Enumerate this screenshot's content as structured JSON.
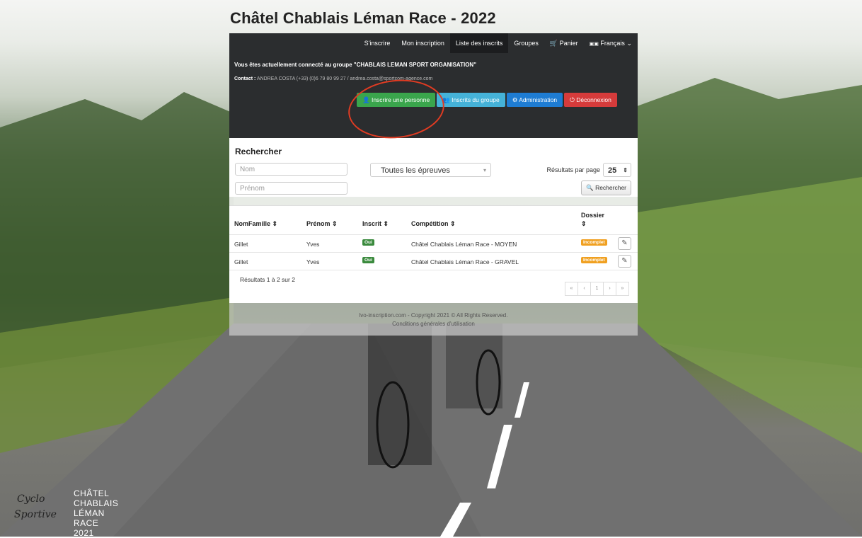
{
  "page_title": "Châtel Chablais Léman Race - 2022",
  "nav": {
    "items": [
      "S'inscrire",
      "Mon inscription",
      "Liste des inscrits",
      "Groupes",
      "Panier",
      "Français"
    ],
    "cart_icon": "cart-icon",
    "flag_icon": "flag-icon"
  },
  "info": {
    "connected": "Vous êtes actuellement connecté au groupe \"CHABLAIS LEMAN SPORT ORGANISATION\"",
    "contact_label": "Contact :",
    "contact_value": "ANDREA COSTA (+33) (0)6 79 80 99 27 / andrea.costa@sportcom-agence.com"
  },
  "actions": {
    "add_person": "Inscrire une personne",
    "group_registrants": "Inscrits du groupe",
    "administration": "Administration",
    "logout": "Déconnexion"
  },
  "search": {
    "heading": "Rechercher",
    "nom_placeholder": "Nom",
    "prenom_placeholder": "Prénom",
    "event_select": "Toutes les épreuves",
    "results_per_page_label": "Résultats par page",
    "results_per_page": "25",
    "search_button": "Rechercher"
  },
  "table": {
    "columns": [
      "NomFamille ⇕",
      "Prénom ⇕",
      "Inscrit ⇕",
      "Compétition ⇕",
      "Dossier",
      "⇕"
    ],
    "rows": [
      {
        "nom": "Gillet",
        "prenom": "Yves",
        "inscrit": "Oui",
        "competition": "Châtel Chablais Léman Race - MOYEN",
        "dossier": "Incomplet"
      },
      {
        "nom": "Gillet",
        "prenom": "Yves",
        "inscrit": "Oui",
        "competition": "Châtel Chablais Léman Race - GRAVEL",
        "dossier": "Incomplet"
      }
    ],
    "results_text": "Résultats 1 à 2 sur 2",
    "pager": [
      "«",
      "‹",
      "1",
      "›",
      "»"
    ]
  },
  "footer": {
    "copyright": "lvo-inscription.com - Copyright 2021 © All Rights Reserved.",
    "terms": "Conditions générales d'utilisation"
  },
  "logo": {
    "script_line1": "Cyclo",
    "script_line2": "Sportive",
    "caps": [
      "CHÂTEL",
      "CHABLAIS",
      "LÉMAN",
      "RACE 2021"
    ]
  }
}
